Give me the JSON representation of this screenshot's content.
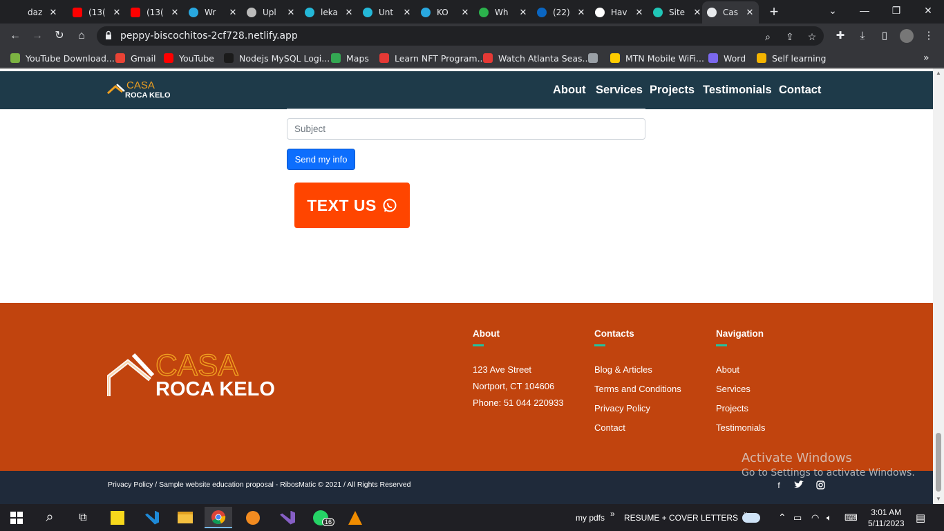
{
  "browser": {
    "tabs": [
      {
        "title": "daz",
        "icon": "generic-icon",
        "active": false
      },
      {
        "title": "(13(",
        "icon": "youtube-icon",
        "active": false
      },
      {
        "title": "(13(",
        "icon": "youtube-icon",
        "active": false
      },
      {
        "title": "Wr",
        "icon": "bird-icon",
        "active": false
      },
      {
        "title": "Upl",
        "icon": "layers-icon",
        "active": false
      },
      {
        "title": "leka",
        "icon": "canva-icon",
        "active": false
      },
      {
        "title": "Unt",
        "icon": "canva-icon",
        "active": false
      },
      {
        "title": "KO",
        "icon": "bird-icon",
        "active": false
      },
      {
        "title": "Wh",
        "icon": "green-square-icon",
        "active": false
      },
      {
        "title": "(22)",
        "icon": "linkedin-icon",
        "active": false
      },
      {
        "title": "Hav",
        "icon": "hashnode-icon",
        "active": false
      },
      {
        "title": "Site",
        "icon": "netlify-icon",
        "active": false
      },
      {
        "title": "Cas",
        "icon": "globe-icon",
        "active": true
      }
    ],
    "url": "peppy-biscochitos-2cf728.netlify.app",
    "bookmarks": [
      {
        "label": "YouTube Download...",
        "icon": "download-arrow-icon"
      },
      {
        "label": "Gmail",
        "icon": "gmail-icon"
      },
      {
        "label": "YouTube",
        "icon": "youtube-icon"
      },
      {
        "label": "Nodejs MySQL Logi...",
        "icon": "sk-icon"
      },
      {
        "label": "Maps",
        "icon": "maps-pin-icon"
      },
      {
        "label": "Learn NFT Program...",
        "icon": "c-icon"
      },
      {
        "label": "Watch Atlanta Seas...",
        "icon": "play-icon"
      },
      {
        "label": "",
        "icon": "globe-icon"
      },
      {
        "label": "MTN Mobile WiFi...",
        "icon": "mtn-icon"
      },
      {
        "label": "Word",
        "icon": "word-icon"
      },
      {
        "label": "Self learning",
        "icon": "bars-icon"
      }
    ]
  },
  "site": {
    "logo": {
      "line1": "CASA",
      "line2": "ROCA KELO"
    },
    "nav": [
      "About",
      "Services",
      "Projects",
      "Testimonials",
      "Contact"
    ],
    "form": {
      "subject_placeholder": "Subject",
      "send_label": "Send my info"
    },
    "text_us": "TEXT US",
    "footer": {
      "about": {
        "heading": "About",
        "lines": [
          "123 Ave Street",
          "Nortport, CT 104606",
          "Phone: 51 044 220933"
        ]
      },
      "contacts": {
        "heading": "Contacts",
        "links": [
          "Blog & Articles",
          "Terms and Conditions",
          "Privacy Policy",
          "Contact"
        ]
      },
      "navigation": {
        "heading": "Navigation",
        "links": [
          "About",
          "Services",
          "Projects",
          "Testimonials"
        ]
      },
      "copyright": "Privacy Policy / Sample website education proposal - RibosMatic © 2021 / All Rights Reserved",
      "social": [
        "facebook-icon",
        "twitter-icon",
        "instagram-icon"
      ]
    }
  },
  "watermark": {
    "line1": "Activate Windows",
    "line2": "Go to Settings to activate Windows."
  },
  "taskbar": {
    "tray_items": [
      "my pdfs",
      "RESUME + COVER LETTERS"
    ],
    "time": "3:01 AM",
    "date": "5/11/2023",
    "whatsapp_badge": "16"
  },
  "colors": {
    "nav_bg": "#1e3a49",
    "footer_bg": "#c1440e",
    "accent_teal": "#21c2a0",
    "text_us_bg": "#ff4500",
    "logo_gold": "#f0a020"
  }
}
